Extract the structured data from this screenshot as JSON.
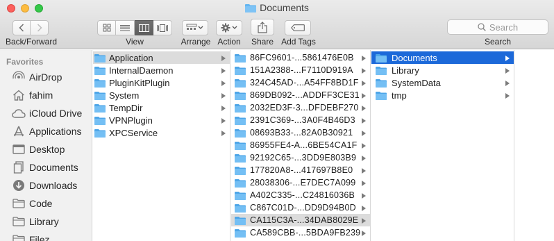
{
  "window": {
    "title": "Documents"
  },
  "toolbar": {
    "back_forward_label": "Back/Forward",
    "view_label": "View",
    "arrange_label": "Arrange",
    "action_label": "Action",
    "share_label": "Share",
    "add_tags_label": "Add Tags",
    "search_label": "Search",
    "search_placeholder": "Search",
    "active_view": "columns"
  },
  "sidebar": {
    "section": "Favorites",
    "items": [
      {
        "label": "AirDrop",
        "icon": "airdrop-icon"
      },
      {
        "label": "fahim",
        "icon": "home-icon"
      },
      {
        "label": "iCloud Drive",
        "icon": "cloud-icon"
      },
      {
        "label": "Applications",
        "icon": "applications-icon"
      },
      {
        "label": "Desktop",
        "icon": "desktop-icon"
      },
      {
        "label": "Documents",
        "icon": "documents-icon"
      },
      {
        "label": "Downloads",
        "icon": "downloads-icon"
      },
      {
        "label": "Code",
        "icon": "folder-icon"
      },
      {
        "label": "Library",
        "icon": "folder-icon"
      },
      {
        "label": "Filez",
        "icon": "folder-icon"
      }
    ]
  },
  "columns": [
    {
      "items": [
        {
          "name": "Application",
          "selected": "gray"
        },
        {
          "name": "InternalDaemon"
        },
        {
          "name": "PluginKitPlugin"
        },
        {
          "name": "System"
        },
        {
          "name": "TempDir"
        },
        {
          "name": "VPNPlugin"
        },
        {
          "name": "XPCService"
        }
      ]
    },
    {
      "items": [
        {
          "name": "86FC9601-...5861476E0B"
        },
        {
          "name": "151A2388-...F7110D919A"
        },
        {
          "name": "324C45AD-...A54FF8BD1F"
        },
        {
          "name": "869DB092-...ADDFF3CE31"
        },
        {
          "name": "2032ED3F-3...DFDEBF270"
        },
        {
          "name": "2391C369-...3A0F4B46D3"
        },
        {
          "name": "08693B33-...82A0B30921"
        },
        {
          "name": "86955FE4-A...6BE54CA1F"
        },
        {
          "name": "92192C65-...3DD9E803B9"
        },
        {
          "name": "177820A8-...417697B8E0"
        },
        {
          "name": "28038306-...E7DEC7A099"
        },
        {
          "name": "A402C335-...C24816036B"
        },
        {
          "name": "C867C01D-...DD9D94B0D"
        },
        {
          "name": "CA115C3A-...34DAB8029E",
          "selected": "gray"
        },
        {
          "name": "CA589CBB-...5BDA9FB239"
        }
      ]
    },
    {
      "items": [
        {
          "name": "Documents",
          "selected": "blue"
        },
        {
          "name": "Library"
        },
        {
          "name": "SystemData"
        },
        {
          "name": "tmp"
        }
      ]
    }
  ],
  "colors": {
    "selection_blue": "#1c69d9",
    "selection_gray": "#dcdcdc",
    "folder_blue": "#64b5f0"
  }
}
